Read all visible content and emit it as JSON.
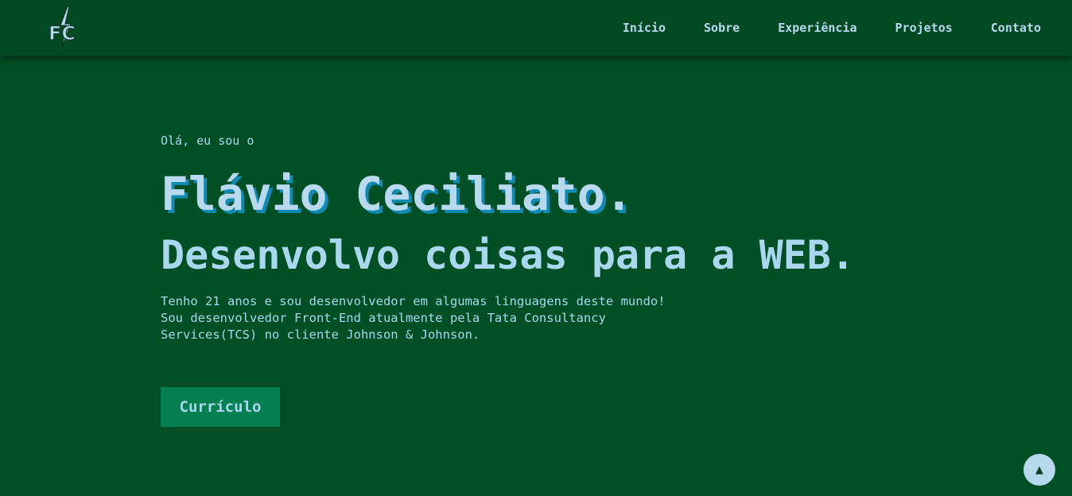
{
  "nav": {
    "logo_text": "FC",
    "items": [
      {
        "label": "Início"
      },
      {
        "label": "Sobre"
      },
      {
        "label": "Experiência"
      },
      {
        "label": "Projetos"
      },
      {
        "label": "Contato"
      }
    ]
  },
  "hero": {
    "greeting": "Olá, eu sou o",
    "name": "Flávio Ceciliato.",
    "tagline": "Desenvolvo coisas para a WEB.",
    "description": [
      "Tenho 21 anos e sou desenvolvedor em algumas linguagens deste mundo!",
      "Sou desenvolvedor Front-End atualmente pela Tata Consultancy",
      "Services(TCS) no cliente Johnson & Johnson."
    ],
    "cv_button": "Currículo"
  },
  "scroll_top": {
    "icon": "arrow-up-icon",
    "glyph": "▲"
  },
  "colors": {
    "background": "#014f25",
    "navbar": "#014a22",
    "text": "#a9d8ee",
    "name_shadow": "#0e8ab3",
    "button": "#048050"
  }
}
